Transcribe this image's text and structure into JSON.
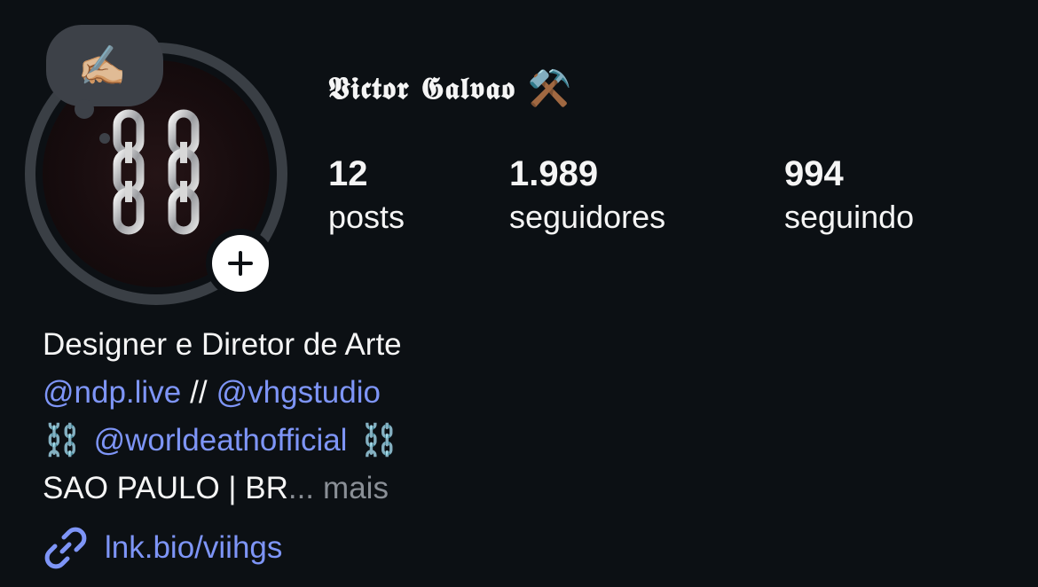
{
  "profile": {
    "display_name": "𝖁𝖎𝖈𝖙𝖔𝖗 𝕲𝖆𝖑𝖛𝖆𝖔",
    "name_emoji": "⚒️",
    "note_emoji": "✍🏼",
    "avatar_icon": "chains-icon",
    "add_icon": "plus-icon"
  },
  "stats": [
    {
      "count": "12",
      "label": "posts"
    },
    {
      "count": "1.989",
      "label": "seguidores"
    },
    {
      "count": "994",
      "label": "seguindo"
    }
  ],
  "bio": {
    "line1": "Designer e Diretor de Arte",
    "mention1": "@ndp.live",
    "separator": "//",
    "mention2": "@vhgstudio",
    "chain_emoji": "⛓️",
    "mention3": "@worldeathofficial",
    "location": "SAO PAULO | BR",
    "ellipsis": "...",
    "more_label": "mais"
  },
  "link": {
    "icon": "link-icon",
    "text": "lnk.bio/viihgs"
  },
  "colors": {
    "background": "#0c1014",
    "text": "#f5f5f5",
    "link": "#7e95f7",
    "muted": "#8a8f96",
    "ring": "#3a3f45"
  }
}
